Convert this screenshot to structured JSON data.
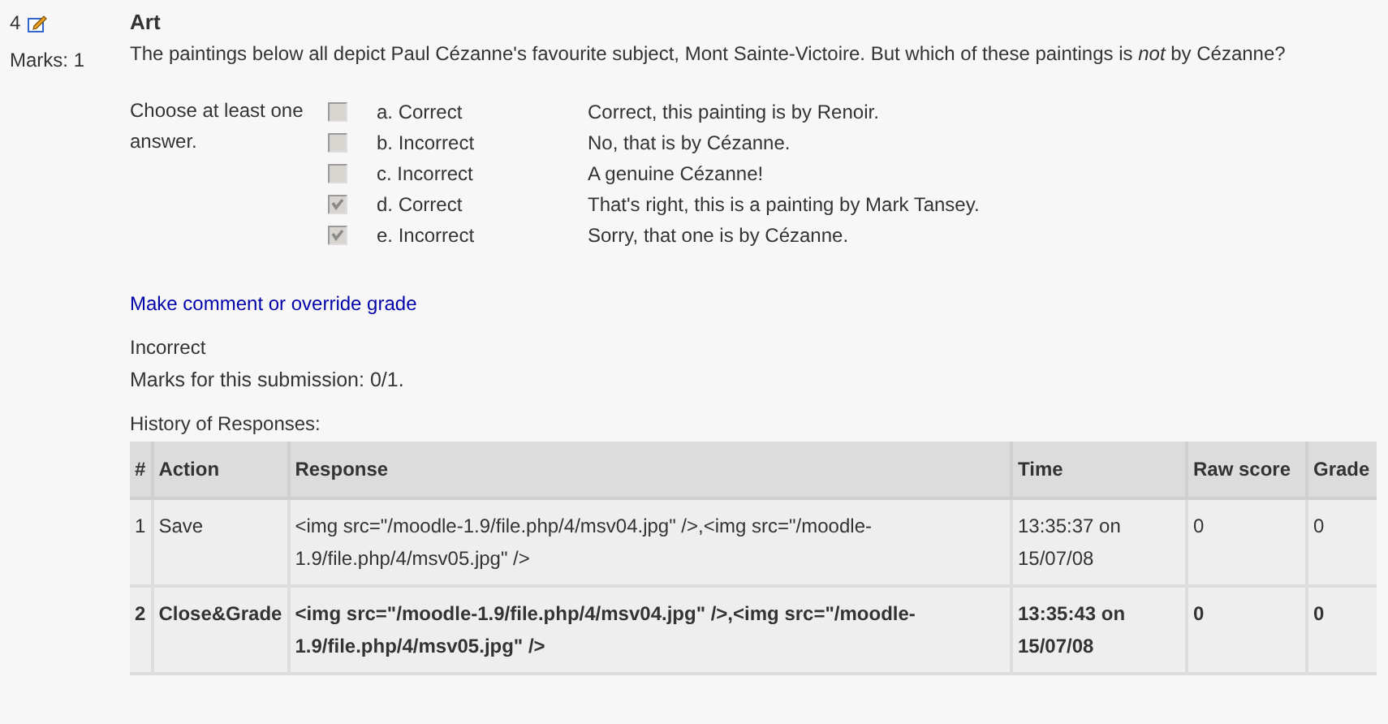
{
  "question": {
    "number": "4",
    "marks": "Marks: 1",
    "title": "Art",
    "text": "The paintings below all depict Paul Cézanne's favourite subject, Mont Sainte-Victoire. But which of these paintings is *not* by Cézanne?",
    "instruction": "Choose at least one answer."
  },
  "options": [
    {
      "label": "a. Correct",
      "checked": false,
      "feedback": "Correct, this painting is by Renoir."
    },
    {
      "label": "b. Incorrect",
      "checked": false,
      "feedback": "No, that is by Cézanne."
    },
    {
      "label": "c. Incorrect",
      "checked": false,
      "feedback": "A genuine Cézanne!"
    },
    {
      "label": "d. Correct",
      "checked": true,
      "feedback": "That's right, this is a painting by Mark Tansey."
    },
    {
      "label": "e. Incorrect",
      "checked": true,
      "feedback": "Sorry, that one is by Cézanne."
    }
  ],
  "comment_link": "Make comment or override grade",
  "result": "Incorrect",
  "submission_marks": "Marks for this submission: 0/1.",
  "history": {
    "title": "History of Responses:",
    "columns": [
      "#",
      "Action",
      "Response",
      "Time",
      "Raw score",
      "Grade"
    ],
    "rows": [
      {
        "cells": [
          "1",
          "Save",
          "<img src=\"/moodle-1.9/file.php/4/msv04.jpg\" />,<img src=\"/moodle-1.9/file.php/4/msv05.jpg\" />",
          "13:35:37 on 15/07/08",
          "0",
          "0"
        ],
        "bold": false
      },
      {
        "cells": [
          "2",
          "Close&Grade",
          "<img src=\"/moodle-1.9/file.php/4/msv04.jpg\" />,<img src=\"/moodle-1.9/file.php/4/msv05.jpg\" />",
          "13:35:43 on 15/07/08",
          "0",
          "0"
        ],
        "bold": true
      }
    ]
  }
}
